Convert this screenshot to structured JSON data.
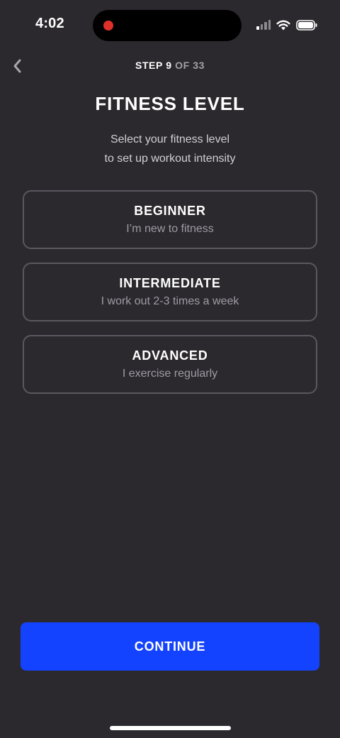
{
  "status_bar": {
    "time": "4:02",
    "recording_color": "#e0302a",
    "icons": [
      "cellular-signal-icon",
      "wifi-icon",
      "battery-icon"
    ]
  },
  "header": {
    "back_icon": "chevron-left-icon",
    "step_prefix": "STEP",
    "step_current": "9",
    "step_of_label": "OF",
    "step_total": "33"
  },
  "title": "FITNESS LEVEL",
  "subtitle_line1": "Select your fitness level",
  "subtitle_line2": "to set up workout intensity",
  "options": [
    {
      "title": "BEGINNER",
      "description": "I’m new to fitness"
    },
    {
      "title": "INTERMEDIATE",
      "description": "I work out 2-3 times a week"
    },
    {
      "title": "ADVANCED",
      "description": "I exercise regularly"
    }
  ],
  "continue_label": "CONTINUE",
  "colors": {
    "background": "#2b292e",
    "accent": "#1443ff",
    "option_border": "#5a585e",
    "muted_text": "#9e9ca2"
  }
}
